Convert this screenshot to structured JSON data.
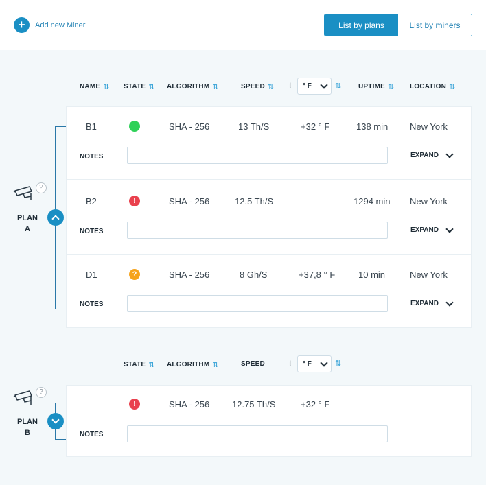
{
  "header": {
    "add_miner_label": "Add new Miner",
    "add_icon": "+",
    "toggle": {
      "plans": "List by plans",
      "miners": "List by miners",
      "active": "plans"
    }
  },
  "columns": {
    "name": "NAME",
    "state": "STATE",
    "algorithm": "ALGORITHM",
    "speed": "SPEED",
    "temp": "t",
    "temp_unit": "° F",
    "uptime": "UPTIME",
    "location": "LOCATION",
    "sort_icon": "⇅"
  },
  "common": {
    "notes": "NOTES",
    "expand": "EXPAND",
    "help": "?"
  },
  "plans": [
    {
      "label_line1": "PLAN",
      "label_line2": "A",
      "collapsed": false,
      "miners": [
        {
          "name": "B1",
          "state": "ok",
          "state_symbol": "",
          "algorithm": "SHA - 256",
          "speed": "13 Th/S",
          "temp": "+32 ° F",
          "uptime": "138 min",
          "location": "New York",
          "notes": ""
        },
        {
          "name": "B2",
          "state": "error",
          "state_symbol": "!",
          "algorithm": "SHA - 256",
          "speed": "12.5 Th/S",
          "temp": "—",
          "uptime": "1294 min",
          "location": "New York",
          "notes": ""
        },
        {
          "name": "D1",
          "state": "warning",
          "state_symbol": "?",
          "algorithm": "SHA - 256",
          "speed": "8 Gh/S",
          "temp": "+37,8 ° F",
          "uptime": "10 min",
          "location": "New York",
          "notes": ""
        }
      ]
    },
    {
      "label_line1": "PLAN",
      "label_line2": "B",
      "collapsed": true,
      "miners": [
        {
          "name": "",
          "state": "error",
          "state_symbol": "!",
          "algorithm": "SHA - 256",
          "speed": "12.75 Th/S",
          "temp": "+32 ° F",
          "notes": ""
        }
      ]
    }
  ],
  "colors": {
    "accent": "#1a8fc4",
    "ok": "#2ed158",
    "error": "#e9414e",
    "warning": "#f6a31b"
  }
}
